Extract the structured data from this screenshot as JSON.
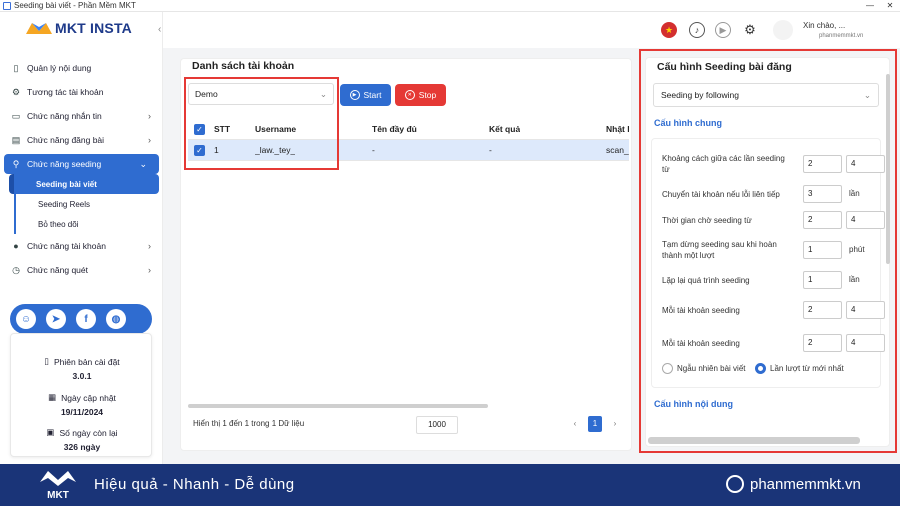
{
  "window": {
    "title": "Seeding bài viết - Phần Mềm MKT",
    "controls": [
      "—",
      "✕"
    ]
  },
  "brand": {
    "logo_text": "MKT INSTA"
  },
  "sidebar": {
    "items": [
      {
        "label": "Quản lý nội dung",
        "icon": "book-icon"
      },
      {
        "label": "Tương tác tài khoản",
        "icon": "interaction-icon"
      },
      {
        "label": "Chức năng nhắn tin",
        "icon": "message-icon"
      },
      {
        "label": "Chức năng đăng bài",
        "icon": "post-icon"
      },
      {
        "label": "Chức năng seeding",
        "icon": "seeding-icon"
      },
      {
        "label": "Chức năng tài khoản",
        "icon": "account-icon"
      },
      {
        "label": "Chức năng quét",
        "icon": "scan-icon"
      }
    ],
    "sub_items": [
      "Seeding bài viết",
      "Seeding Reels",
      "Bỏ theo dõi"
    ],
    "social": [
      "support-icon",
      "telegram-icon",
      "facebook-icon",
      "web-icon"
    ],
    "info": {
      "version_label": "Phiên bản cài đặt",
      "version_value": "3.0.1",
      "update_label": "Ngày cập nhật",
      "update_value": "19/11/2024",
      "days_label": "Số ngày còn lại",
      "days_value": "326 ngày"
    }
  },
  "topbar": {
    "user_name": "Xin chào, ...",
    "user_sub": "phanmemmkt.vn"
  },
  "accounts": {
    "title": "Danh sách tài khoản",
    "select_value": "Demo",
    "start_label": "Start",
    "stop_label": "Stop",
    "columns": [
      "STT",
      "Username",
      "Tên đầy đủ",
      "Kết quả",
      "Nhật k"
    ],
    "rows": [
      {
        "stt": "1",
        "username": "_law._tey_",
        "fullname": "-",
        "result": "-",
        "log": "scan_"
      }
    ],
    "footer": "Hiển thị 1 đến 1 trong 1 Dữ liệu",
    "page_size": "1000",
    "page": "1"
  },
  "config": {
    "title": "Cấu hình Seeding bài đăng",
    "select_value": "Seeding by following",
    "general_heading": "Cấu hình chung",
    "content_heading": "Cấu hình nội dung",
    "rows": [
      {
        "label": "Khoảng cách giữa các lần seeding từ",
        "a": "2",
        "b": "4",
        "unit": ""
      },
      {
        "label": "Chuyển tài khoản nếu lỗi liên tiếp",
        "a": "3",
        "b": "",
        "unit": "lần"
      },
      {
        "label": "Thời gian chờ seeding từ",
        "a": "2",
        "b": "4",
        "unit": ""
      },
      {
        "label": "Tạm dừng seeding sau khi hoàn thành một lượt",
        "a": "1",
        "b": "",
        "unit": "phút"
      },
      {
        "label": "Lặp lại quá trình seeding",
        "a": "1",
        "b": "",
        "unit": "lần"
      },
      {
        "label": "Mỗi tài khoản seeding",
        "a": "2",
        "b": "4",
        "unit": ""
      },
      {
        "label": "Mỗi tài khoản seeding",
        "a": "2",
        "b": "4",
        "unit": ""
      }
    ],
    "radio_random": "Ngẫu nhiên bài viết",
    "radio_sequential": "Lần lượt từ mới nhất"
  },
  "banner": {
    "slogan": "Hiệu quả - Nhanh - Dễ dùng",
    "site": "phanmemmkt.vn",
    "logo_text": "MKT"
  }
}
